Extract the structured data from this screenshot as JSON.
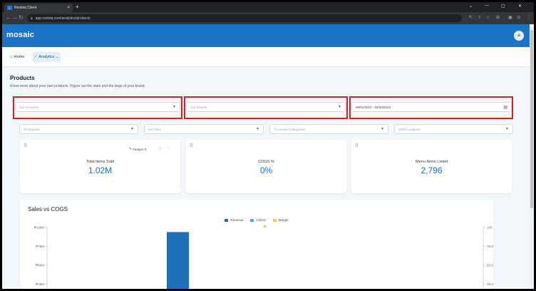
{
  "browser": {
    "tab_title": "Restoiq Client",
    "tab_close": "×",
    "new_tab": "+",
    "url": "app.restoiq.com/analytics/products",
    "window_controls": [
      "⌄",
      "—",
      "▢",
      "✕"
    ]
  },
  "app": {
    "logo": "mosaic",
    "avatar": "a",
    "nav": [
      {
        "label": "Home",
        "icon": "home-icon"
      },
      {
        "label": "Analytics",
        "icon": "trend-icon"
      }
    ]
  },
  "page": {
    "title": "Products",
    "subtitle": "Know more about your own products. Figure out the stars and the dogs of your brand."
  },
  "filters": {
    "accounts": "164 Accounts",
    "brands": "104 Brands",
    "date_range": "09/01/2023 - 09/30/2023",
    "regions": "10 Regions",
    "cities": "34 Cities",
    "location_categories": "7 Location Categories",
    "locations": "2000 Locations"
  },
  "kpis": [
    {
      "label": "Total Items Sold",
      "value": "1.02M",
      "analyze": "Analyze It"
    },
    {
      "label": "COGS %",
      "value": "0%"
    },
    {
      "label": "Menu Items Listed",
      "value": "2,796"
    }
  ],
  "chart": {
    "title": "Sales vs COGS",
    "legend": [
      {
        "name": "Revenue",
        "color": "#1f6fb8"
      },
      {
        "name": "COGS",
        "color": "#2fb6e8"
      },
      {
        "name": "Margin",
        "color": "#f2c94c"
      }
    ]
  },
  "chart_data": {
    "type": "bar",
    "title": "Sales vs COGS",
    "series": [
      {
        "name": "Revenue",
        "values": [
          94
        ]
      },
      {
        "name": "COGS",
        "values": [
          0
        ]
      },
      {
        "name": "Margin",
        "values": [
          0
        ]
      }
    ],
    "y_left_ticks": [
      "₱100M",
      "₱75M",
      "₱50M",
      "₱25M"
    ],
    "y_right_ticks": [
      "100.00%",
      "75.00%",
      "50.00%",
      "25.00%"
    ],
    "ylim": [
      0,
      100
    ],
    "unit": "M"
  }
}
